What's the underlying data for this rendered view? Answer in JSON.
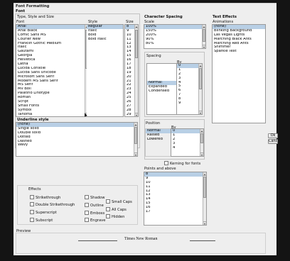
{
  "dialog": {
    "title": "Font Formatting"
  },
  "font_group": {
    "title": "Font",
    "subtitle": "Type, Style and Size",
    "col_font": "Font",
    "col_style": "Style",
    "col_size": "Size",
    "fonts": [
      "Arial",
      "Arial Black",
      "Comic Sans MS",
      "Courier New",
      "Franklin Gothic Medium",
      "Italic",
      "Gautami",
      "Georgia",
      "Helvetica",
      "Latha",
      "Lucida Console",
      "Lucida Sans Unicode",
      "Microsoft Sans Serif",
      "Modern MS Sans Serif",
      "MS Serif",
      "Mv Boli",
      "Palatino Linotype",
      "Roman",
      "Script",
      "Small Fonts",
      "Symbol",
      "Tahoma"
    ],
    "styles": [
      "Regular",
      "Italic",
      "Bold",
      "Bold Italic"
    ],
    "sizes": [
      "8",
      "9",
      "10",
      "11",
      "12",
      "13",
      "14",
      "15",
      "16",
      "17",
      "18",
      "19",
      "20",
      "21",
      "22",
      "23",
      "24",
      "25",
      "26",
      "27",
      "28",
      "29"
    ]
  },
  "char_spacing": {
    "title": "Character Spacing",
    "scale_label": "Scale",
    "scales": [
      "100%",
      "150%",
      "200%",
      "90%",
      "80%"
    ],
    "spacing_label": "Spacing",
    "by_label": "By",
    "spacing_options": [
      "Normal",
      "Expanded",
      "Condensed"
    ],
    "by_values": [
      "0",
      "1",
      "2",
      "3",
      "4",
      "5",
      "6",
      "7",
      "8",
      "9"
    ]
  },
  "text_effects": {
    "title": "Text Effects",
    "animations_label": "Animations",
    "animations": [
      "(none)",
      "Blinking Background",
      "Las Vegas Lights",
      "Marching Black Ants",
      "Marching Red Ants",
      "Shimmer",
      "Sparkle Text"
    ]
  },
  "position": {
    "title": "Position",
    "by_label": "By",
    "options": [
      "Normal",
      "Raised",
      "Lowered"
    ],
    "by_values": [
      "0",
      "1",
      "2",
      "3",
      "4"
    ]
  },
  "kerning": {
    "label": "Kerning for fonts",
    "points_label": "Points and above",
    "points": [
      "8",
      "9",
      "10",
      "11",
      "12",
      "13",
      "14",
      "15",
      "16",
      "17"
    ]
  },
  "underline": {
    "title": "Underline style",
    "options": [
      "(none)",
      "Single solid",
      "Double solid",
      "Dotted",
      "Dashed",
      "Wavy"
    ]
  },
  "effects": {
    "title": "Effects",
    "items": [
      "Strikethrough",
      "Double Strikethrough",
      "Superscript",
      "Subscript",
      "Shadow",
      "Outline",
      "Emboss",
      "Engrave",
      "Small Caps",
      "All Caps",
      "Hidden"
    ]
  },
  "preview": {
    "title": "Preview",
    "sample": "Times New Roman"
  },
  "buttons": {
    "ok": "Ok",
    "cancel": "Cancel"
  }
}
